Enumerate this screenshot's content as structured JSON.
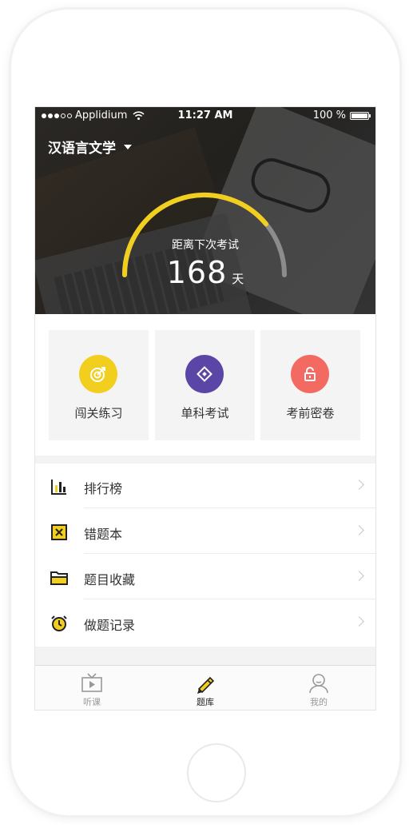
{
  "colors": {
    "accent_yellow": "#F2CF1F",
    "accent_purple": "#5B46A8",
    "accent_red": "#F26A62",
    "text_dark": "#333333",
    "text_muted": "#999999",
    "gauge_track": "#8c8c8c"
  },
  "status_bar": {
    "carrier": "Applidium",
    "time": "11:27 AM",
    "battery": "100 %",
    "signal_dots_filled": 3,
    "signal_dots_total": 5
  },
  "header": {
    "subject": "汉语言文学",
    "subject_icon": "caret-down-icon",
    "countdown_label": "距离下次考试",
    "countdown_days": "168",
    "countdown_unit": "天",
    "gauge_progress": 0.78
  },
  "tiles": [
    {
      "label": "闯关练习",
      "icon": "target-icon",
      "color": "#F2CF1F"
    },
    {
      "label": "单科考试",
      "icon": "diamond-icon",
      "color": "#5B46A8"
    },
    {
      "label": "考前密卷",
      "icon": "lock-icon",
      "color": "#F26A62"
    }
  ],
  "menu": [
    {
      "label": "排行榜",
      "icon": "bar-chart-icon"
    },
    {
      "label": "错题本",
      "icon": "wrong-book-icon"
    },
    {
      "label": "题目收藏",
      "icon": "folder-icon"
    },
    {
      "label": "做题记录",
      "icon": "alarm-clock-icon"
    }
  ],
  "tabbar": [
    {
      "label": "听课",
      "icon": "tv-icon",
      "active": false
    },
    {
      "label": "题库",
      "icon": "pencil-icon",
      "active": true
    },
    {
      "label": "我的",
      "icon": "user-icon",
      "active": false
    }
  ]
}
